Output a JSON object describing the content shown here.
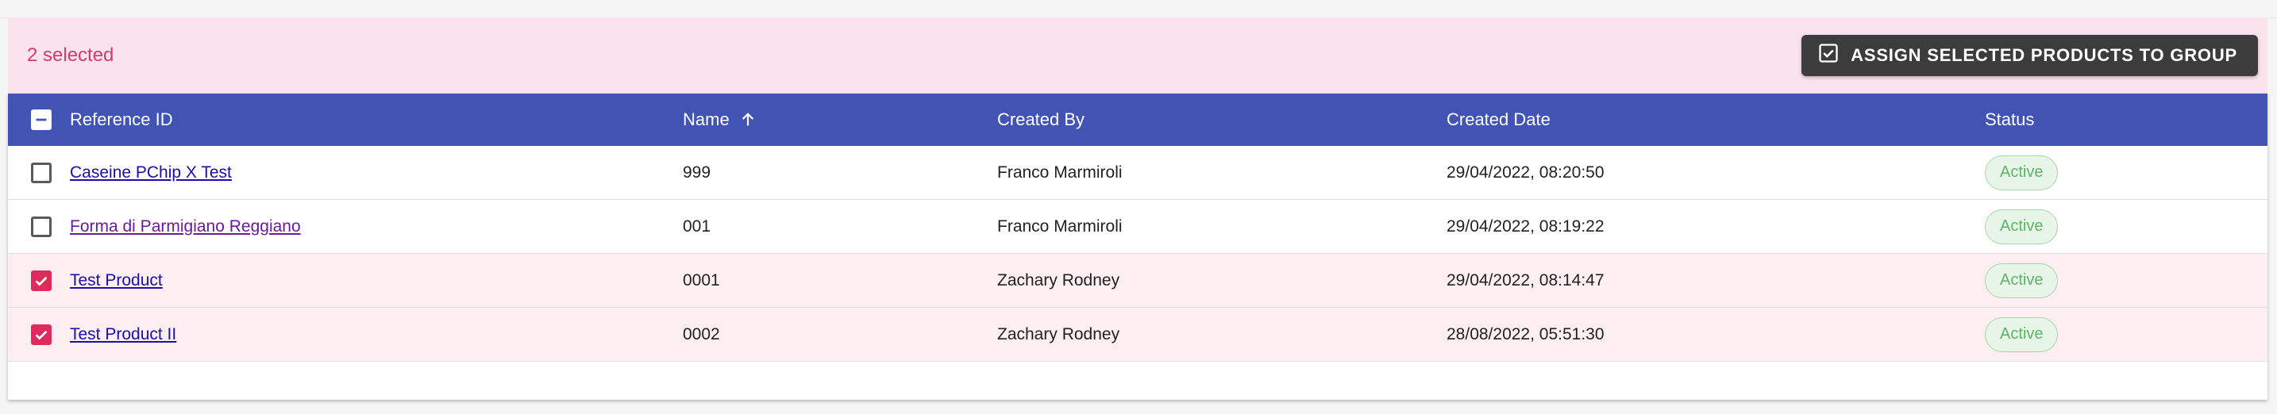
{
  "selection": {
    "count_text": "2 selected",
    "assign_label": "ASSIGN SELECTED PRODUCTS TO GROUP"
  },
  "table": {
    "columns": {
      "reference_id": "Reference ID",
      "name": "Name",
      "created_by": "Created By",
      "created_date": "Created Date",
      "status": "Status"
    },
    "sort": {
      "column": "Name",
      "direction": "ascending"
    },
    "header_checkbox_state": "indeterminate",
    "rows": [
      {
        "reference_id": "Caseine PChip X Test",
        "name": "999",
        "created_by": "Franco Marmiroli",
        "created_date": "29/04/2022, 08:20:50",
        "status": "Active",
        "checked": false
      },
      {
        "reference_id": "Forma di Parmigiano Reggiano",
        "name": "001",
        "created_by": "Franco Marmiroli",
        "created_date": "29/04/2022, 08:19:22",
        "status": "Active",
        "checked": false
      },
      {
        "reference_id": "Test Product",
        "name": "0001",
        "created_by": "Zachary Rodney",
        "created_date": "29/04/2022, 08:14:47",
        "status": "Active",
        "checked": true
      },
      {
        "reference_id": "Test Product II",
        "name": "0002",
        "created_by": "Zachary Rodney",
        "created_date": "28/08/2022, 05:51:30",
        "status": "Active",
        "checked": true
      }
    ]
  },
  "colors": {
    "header_bg": "#4153b3",
    "selection_bg": "#fae3ec",
    "accent": "#dd2c5c",
    "status_green": "#5fb465"
  }
}
